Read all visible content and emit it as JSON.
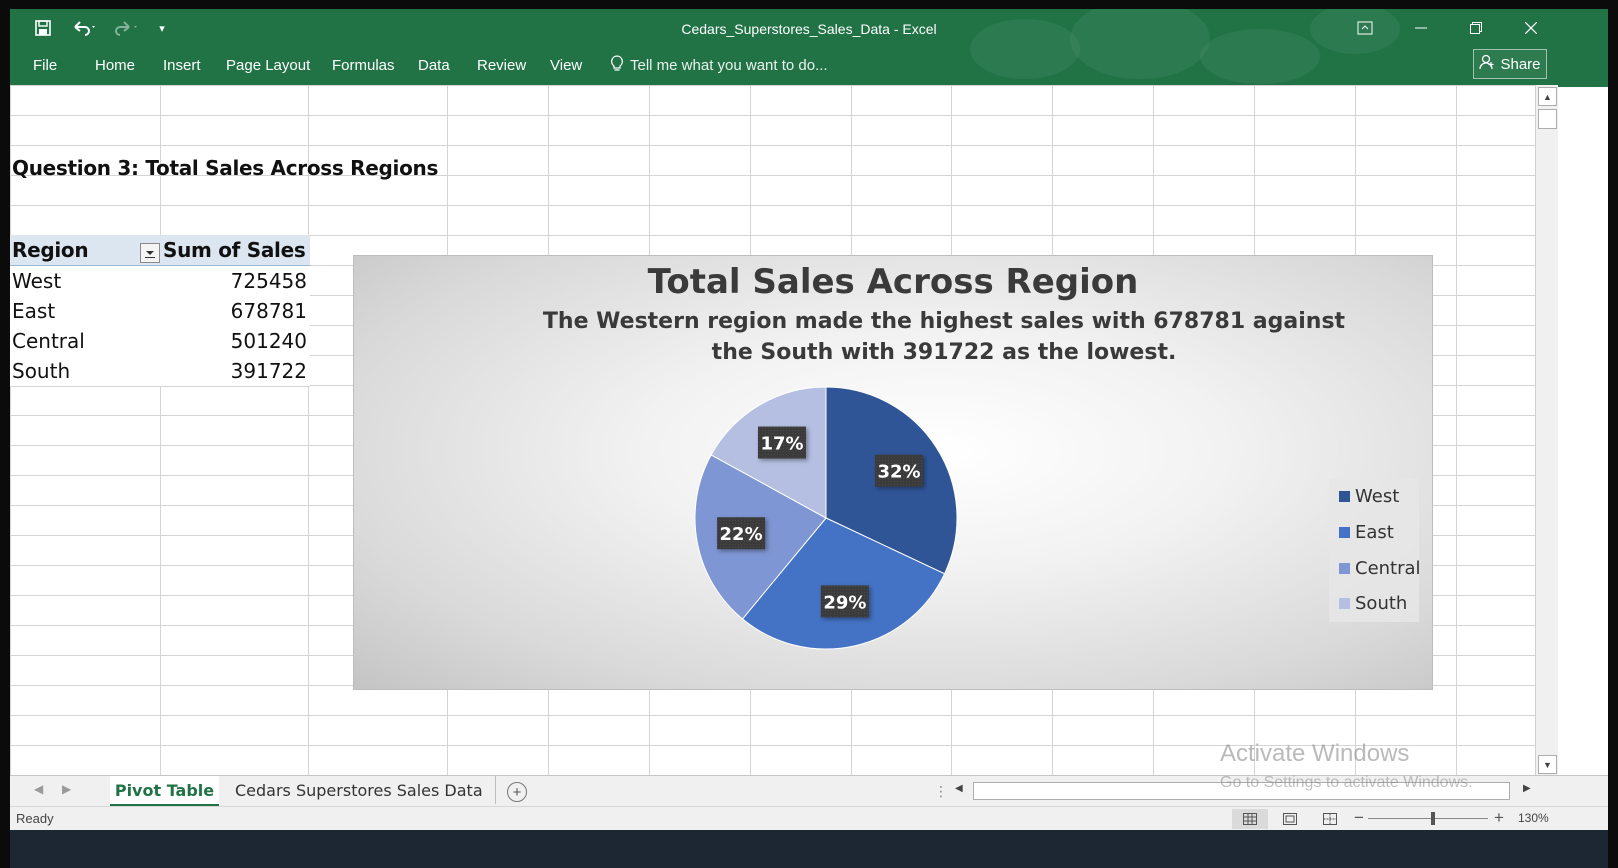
{
  "window": {
    "title": "Cedars_Superstores_Sales_Data - Excel"
  },
  "quick_access": {
    "save_icon": "save-icon",
    "undo_icon": "undo-icon",
    "redo_icon": "redo-icon",
    "customize_icon": "customize-qat-icon"
  },
  "ribbon": {
    "tabs": [
      "File",
      "Home",
      "Insert",
      "Page Layout",
      "Formulas",
      "Data",
      "Review",
      "View"
    ],
    "tell_me": "Tell me what you want to do...",
    "share": "Share"
  },
  "sheet": {
    "question_title": "Question 3: Total Sales Across Regions",
    "pivot": {
      "headers": [
        "Region",
        "Sum of Sales"
      ],
      "rows": [
        {
          "region": "West",
          "sales": "725458"
        },
        {
          "region": "East",
          "sales": "678781"
        },
        {
          "region": "Central",
          "sales": "501240"
        },
        {
          "region": "South",
          "sales": "391722"
        }
      ]
    }
  },
  "chart_data": {
    "type": "pie",
    "title": "Total Sales Across Region",
    "subtitle": "The Western region made the highest sales with 678781 against the South with 391722 as the lowest.",
    "categories": [
      "West",
      "East",
      "Central",
      "South"
    ],
    "values": [
      32,
      29,
      22,
      17
    ],
    "data_labels": [
      "32%",
      "29%",
      "22%",
      "17%"
    ],
    "colors": [
      "#2f5597",
      "#4472c4",
      "#7f96d4",
      "#b4bfe2"
    ],
    "legend_placement": "right"
  },
  "sheet_tabs": {
    "tabs": [
      "Pivot Table",
      "Cedars Superstores Sales Data"
    ],
    "active": "Pivot Table"
  },
  "status": {
    "text": "Ready",
    "zoom": "130%"
  },
  "watermark": {
    "title": "Activate Windows",
    "subtitle": "Go to Settings to activate Windows."
  },
  "colors": {
    "excel_green": "#217346",
    "pivot_header": "#dce6f1"
  }
}
